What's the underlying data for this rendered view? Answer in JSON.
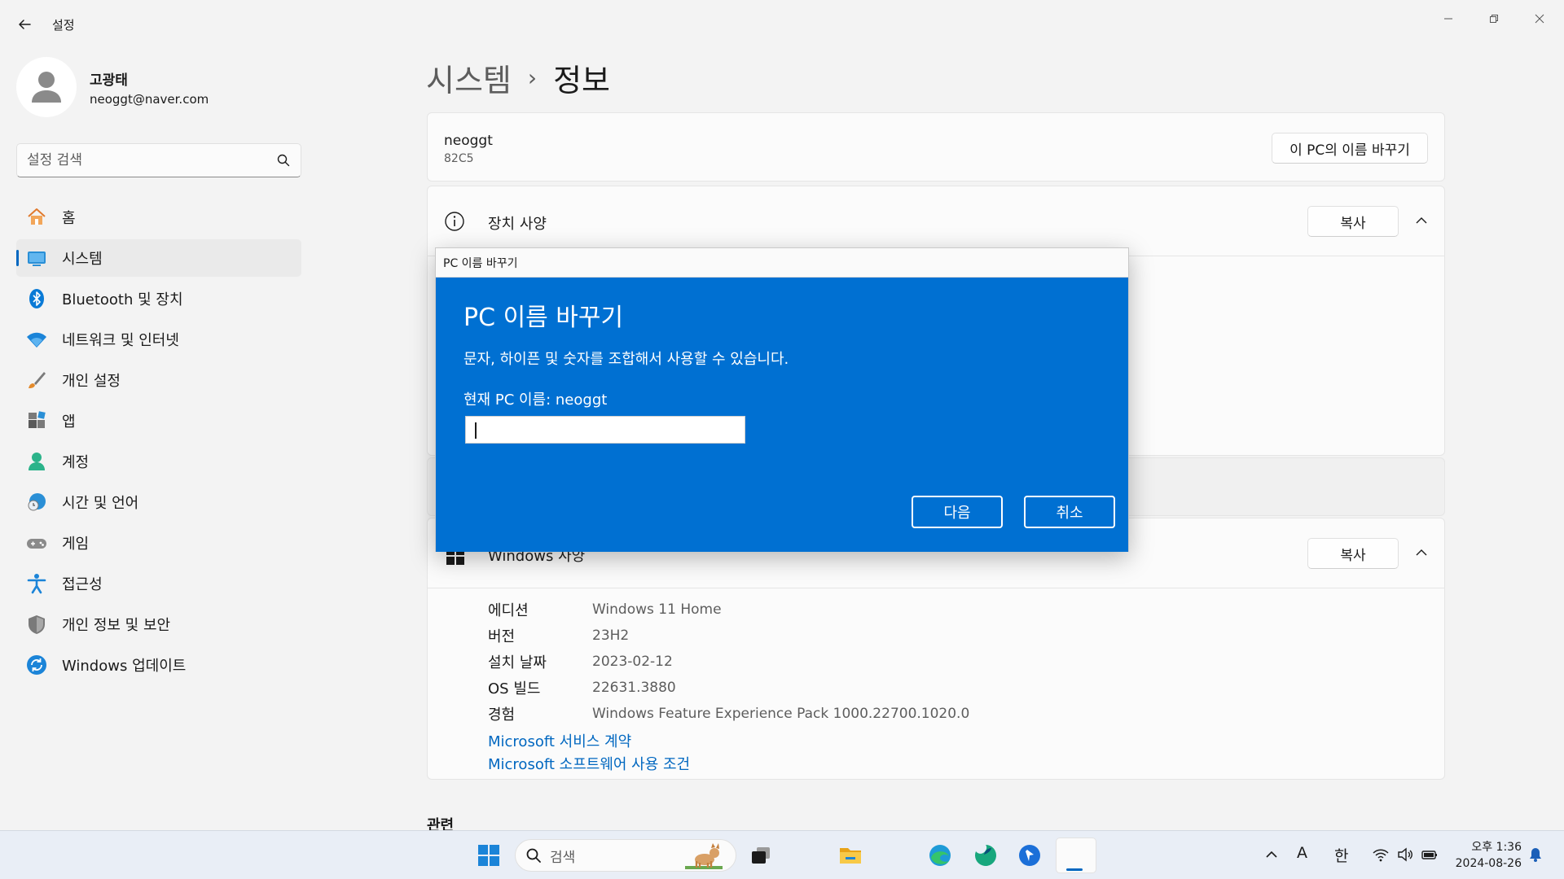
{
  "window": {
    "title": "설정",
    "back_icon": "back-arrow-icon"
  },
  "profile": {
    "name": "고광태",
    "email": "neoggt@naver.com"
  },
  "search": {
    "placeholder": "설정 검색"
  },
  "sidebar": {
    "items": [
      {
        "label": "홈",
        "icon": "home-icon",
        "active": false
      },
      {
        "label": "시스템",
        "icon": "system-icon",
        "active": true
      },
      {
        "label": "Bluetooth 및 장치",
        "icon": "bluetooth-icon",
        "active": false
      },
      {
        "label": "네트워크 및 인터넷",
        "icon": "wifi-icon",
        "active": false
      },
      {
        "label": "개인 설정",
        "icon": "brush-icon",
        "active": false
      },
      {
        "label": "앱",
        "icon": "apps-icon",
        "active": false
      },
      {
        "label": "계정",
        "icon": "account-icon",
        "active": false
      },
      {
        "label": "시간 및 언어",
        "icon": "globe-clock-icon",
        "active": false
      },
      {
        "label": "게임",
        "icon": "gamepad-icon",
        "active": false
      },
      {
        "label": "접근성",
        "icon": "accessibility-icon",
        "active": false
      },
      {
        "label": "개인 정보 및 보안",
        "icon": "shield-icon",
        "active": false
      },
      {
        "label": "Windows 업데이트",
        "icon": "update-icon",
        "active": false
      }
    ]
  },
  "main": {
    "breadcrumb_parent": "시스템",
    "breadcrumb_separator": "›",
    "breadcrumb_current": "정보",
    "pc_name": "neoggt",
    "pc_model": "82C5",
    "rename_button": "이 PC의 이름 바꾸기",
    "device_specs_title": "장치 사양",
    "copy_button": "복사",
    "windows_specs_title": "Windows 사양",
    "windows_specs": [
      {
        "key": "에디션",
        "value": "Windows 11 Home"
      },
      {
        "key": "버전",
        "value": "23H2"
      },
      {
        "key": "설치 날짜",
        "value": "2023-02-12"
      },
      {
        "key": "OS 빌드",
        "value": "22631.3880"
      },
      {
        "key": "경험",
        "value": "Windows Feature Experience Pack 1000.22700.1020.0"
      }
    ],
    "links": [
      "Microsoft 서비스 계약",
      "Microsoft 소프트웨어 사용 조건"
    ],
    "related_label": "관련"
  },
  "dialog": {
    "window_title": "PC 이름 바꾸기",
    "heading": "PC 이름 바꾸기",
    "description": "문자, 하이픈 및 숫자를 조합해서 사용할 수 있습니다.",
    "current_name": "현재 PC 이름: neoggt",
    "input_value": "",
    "next_button": "다음",
    "cancel_button": "취소"
  },
  "taskbar": {
    "search_label": "검색",
    "tray_language_a": "A",
    "tray_ime": "한",
    "clock_time": "오후 1:36",
    "clock_date": "2024-08-26"
  },
  "colors": {
    "accent": "#0067c0",
    "dialog_blue": "#0070d2"
  }
}
